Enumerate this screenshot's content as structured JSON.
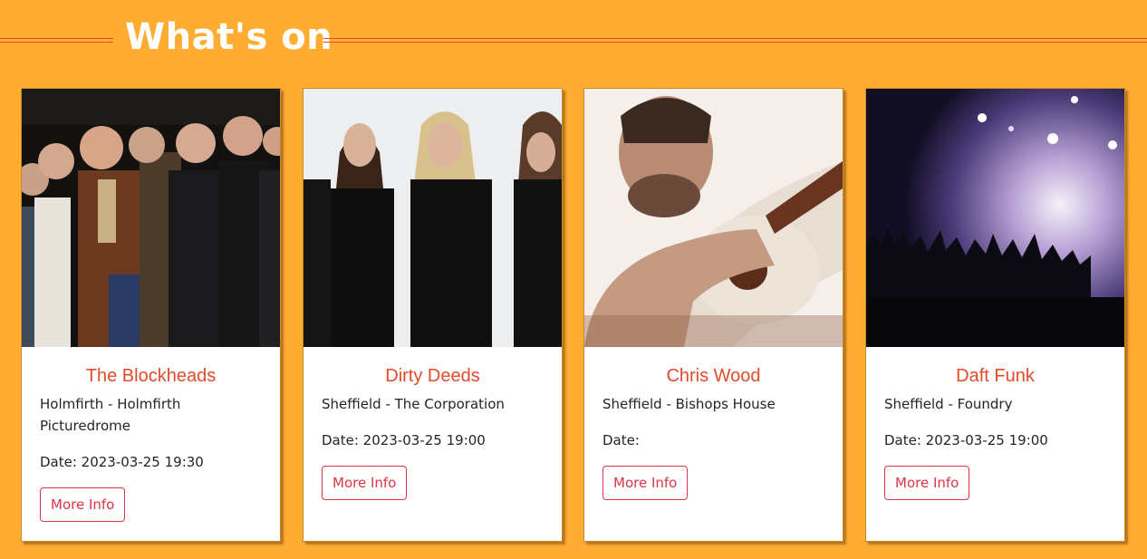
{
  "page": {
    "title": "What's on"
  },
  "colors": {
    "background": "#FFAC33",
    "accent": "#E24B2B",
    "button": "#DC3545"
  },
  "events": [
    {
      "name": "The Blockheads",
      "venue": "Holmfirth - Holmfirth Picturedrome",
      "date": "Date: 2023-03-25 19:30",
      "button_label": "More Info",
      "image": "band-photo-dark-background"
    },
    {
      "name": "Dirty Deeds",
      "venue": "Sheffield - The Corporation",
      "date": "Date: 2023-03-25 19:00",
      "button_label": "More Info",
      "image": "band-photo-white-background"
    },
    {
      "name": "Chris Wood",
      "venue": "Sheffield - Bishops House",
      "date": "Date:",
      "button_label": "More Info",
      "image": "guitarist-sepia-portrait"
    },
    {
      "name": "Daft Funk",
      "venue": "Sheffield - Foundry",
      "date": "Date: 2023-03-25 19:00",
      "button_label": "More Info",
      "image": "concert-crowd-stage-lights"
    }
  ]
}
